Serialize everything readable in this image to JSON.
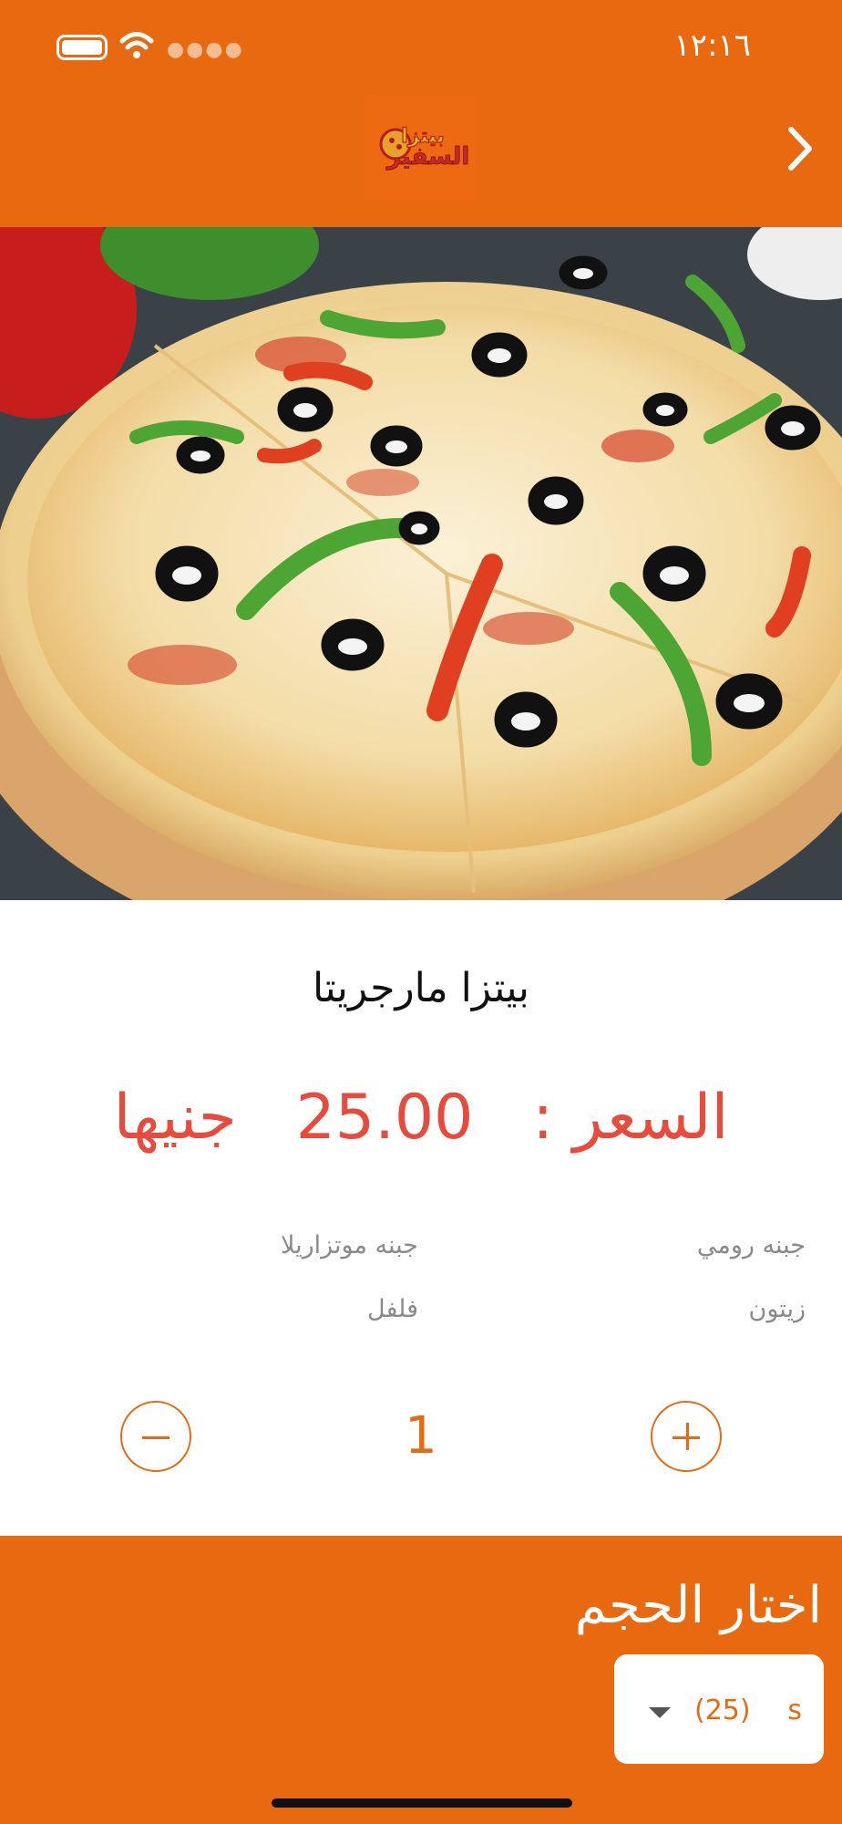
{
  "status_bar": {
    "time": "١٢:١٦"
  },
  "header": {
    "logo_text": "بيتزا السفير"
  },
  "product": {
    "name": "بيتزا مارجريتا",
    "price_label": "السعر :",
    "price_value": "25.00",
    "currency": "جنيها"
  },
  "ingredients": [
    "جبنه رومي",
    "جبنه موتزاريلا",
    "زيتون",
    "فلفل"
  ],
  "quantity": {
    "value": "1"
  },
  "size": {
    "title": "اختار الحجم",
    "selected_size": "s",
    "selected_price": "(25)"
  },
  "colors": {
    "accent": "#E8690F",
    "price": "#E84A3C"
  }
}
